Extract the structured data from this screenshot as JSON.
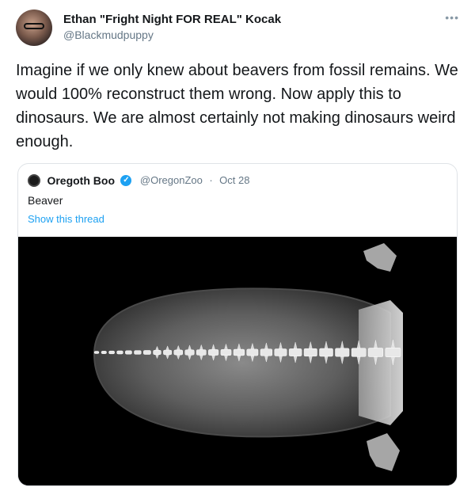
{
  "author": {
    "name": "Ethan \"Fright Night FOR REAL\" Kocak",
    "handle": "@Blackmudpuppy",
    "avatar_icon": "avatar-photo-icon",
    "more_icon": "more-options-icon"
  },
  "tweet": {
    "text": "Imagine if we only knew about beavers from fossil remains. We would 100% reconstruct them wrong. Now apply this to dinosaurs. We are almost certainly not making dinosaurs weird enough."
  },
  "quoted": {
    "name": "Oregoth Boo",
    "handle": "@OregonZoo",
    "separator": "·",
    "date": "Oct 28",
    "text": "Beaver",
    "show_thread": "Show this thread",
    "verified_icon": "verified-badge-icon",
    "image_icon": "beaver-tail-xray-image",
    "link_color": "#1da1f2"
  }
}
